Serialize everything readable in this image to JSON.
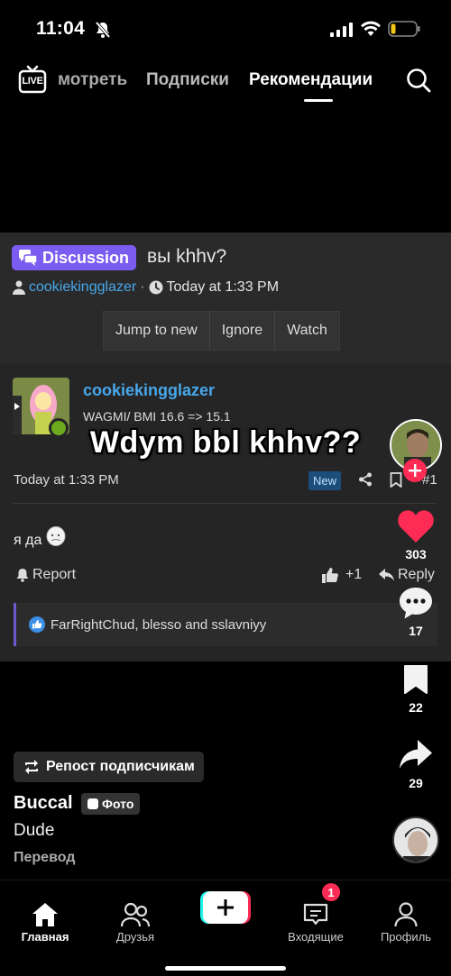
{
  "status_bar": {
    "time": "11:04",
    "silent_icon": "bell-slash-icon",
    "signal_icon": "cellular-signal-icon",
    "wifi_icon": "wifi-icon",
    "battery_icon": "battery-low-icon"
  },
  "top_nav": {
    "live_label": "LIVE",
    "tabs": [
      {
        "label": "мотреть"
      },
      {
        "label": "Подписки"
      },
      {
        "label": "Рекомендации",
        "active": true
      }
    ],
    "search_icon": "search-icon"
  },
  "forum": {
    "badge": "Discussion",
    "thread_title": "вы khhv?",
    "author": "cookiekingglazer",
    "timestamp": "Today at 1:33 PM",
    "buttons": [
      "Jump to new",
      "Ignore",
      "Watch"
    ],
    "poster": {
      "name": "cookiekingglazer",
      "title": "WAGMI/ BMI 16.6 => 15.1"
    },
    "post_date": "Today at 1:33 PM",
    "new_badge": "New",
    "post_number": "#1",
    "body": "я да",
    "report": "Report",
    "like_count": "+1",
    "reply": "Reply",
    "reactions_text": "FarRightChud, blesso and sslavniyy"
  },
  "overlay_caption": "Wdym bbl khhv??",
  "right_rail": {
    "likes": "303",
    "comments": "17",
    "saves": "22",
    "shares": "29"
  },
  "video_info": {
    "repost_label": "Репост подписчикам",
    "author": "Buccal",
    "photo_tag": "Фото",
    "caption": "Dude",
    "translate": "Перевод"
  },
  "bottom_nav": {
    "items": [
      {
        "label": "Главная"
      },
      {
        "label": "Друзья"
      },
      {
        "label": ""
      },
      {
        "label": "Входящие",
        "badge": "1"
      },
      {
        "label": "Профиль"
      }
    ]
  },
  "colors": {
    "accent_red": "#fe2c55",
    "link_blue": "#47a7eb",
    "discussion_purple": "#7a5cf0"
  }
}
